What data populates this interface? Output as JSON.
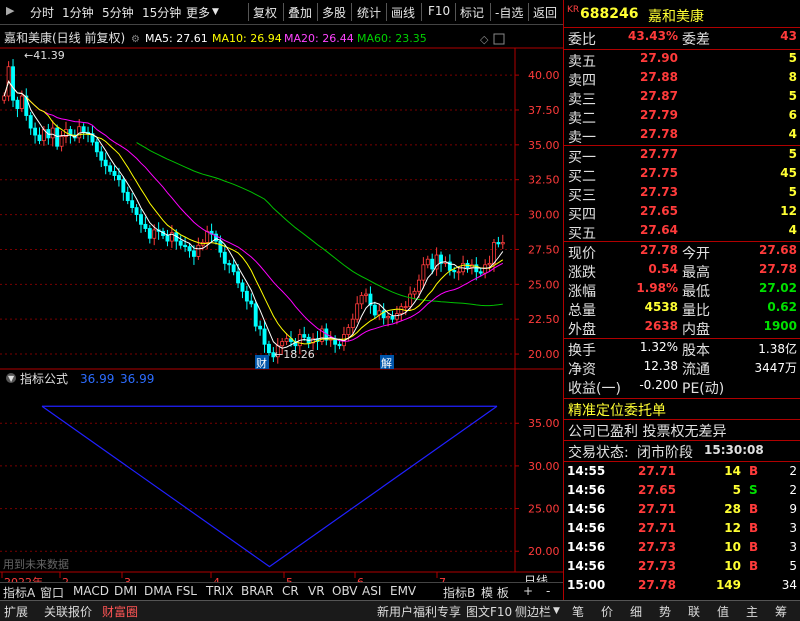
{
  "toolbar": {
    "left_items": [
      "分时",
      "1分钟",
      "5分钟",
      "15分钟",
      "更多"
    ],
    "right_items": [
      "复权",
      "叠加",
      "多股",
      "统计",
      "画线",
      "F10",
      "标记",
      "-自选",
      "返回"
    ]
  },
  "chart": {
    "title": "嘉和美康(日线 前复权)",
    "ma5_label": "MA5: 27.61",
    "ma10_label": "MA10: 26.94",
    "ma20_label": "MA20: 26.44",
    "ma60_label": "MA60: 23.35",
    "high_marker": "41.39",
    "low_marker": "18.26",
    "event_cai": "财",
    "event_jie": "解",
    "indicator_title": "指标公式",
    "indicator_val1": "36.99",
    "indicator_val2": "36.99",
    "future_note": "用到未来数据",
    "period_label": "日线",
    "colors": {
      "ma5": "#ffffff",
      "ma10": "#ffff00",
      "ma20": "#ff00ff",
      "ma60": "#00c000",
      "up": "#ff3b3b",
      "down": "#00ffff",
      "indicator": "#2020ff"
    }
  },
  "chart_data": [
    {
      "type": "candlestick",
      "title": "嘉和美康(日线 前复权)",
      "yticks": [
        "40.00",
        "37.50",
        "35.00",
        "32.50",
        "30.00",
        "27.50",
        "25.00",
        "22.50",
        "20.00"
      ],
      "ylim": [
        19.0,
        41.8
      ],
      "xticks": [
        "2022年",
        "2",
        "3",
        "4",
        "5",
        "6",
        "7"
      ],
      "series": [
        {
          "name": "MA5",
          "last": 27.61
        },
        {
          "name": "MA10",
          "last": 26.94
        },
        {
          "name": "MA20",
          "last": 26.44
        },
        {
          "name": "MA60",
          "last": 23.35
        }
      ],
      "annotations": [
        {
          "text": "41.39",
          "kind": "high"
        },
        {
          "text": "18.26",
          "kind": "low"
        }
      ],
      "close_series": [
        38.5,
        40.6,
        38.2,
        37.6,
        38.5,
        37.1,
        36.2,
        35.7,
        35.3,
        36.1,
        35.5,
        36.2,
        34.9,
        35.6,
        36.1,
        35.7,
        35.5,
        36.3,
        35.9,
        35.8,
        35.2,
        34.5,
        33.9,
        33.5,
        33.1,
        32.8,
        32.5,
        31.6,
        31.0,
        30.5,
        30.0,
        29.3,
        29.0,
        28.3,
        28.9,
        28.8,
        28.5,
        28.1,
        28.7,
        28.1,
        27.8,
        27.7,
        27.4,
        27.0,
        27.8,
        28.0,
        28.8,
        28.6,
        28.1,
        27.3,
        26.5,
        26.4,
        25.9,
        25.1,
        24.5,
        23.8,
        23.6,
        22.0,
        21.8,
        20.7,
        20.1,
        19.8,
        20.6,
        20.9,
        21.1,
        20.9,
        20.6,
        21.4,
        21.2,
        20.8,
        21.1,
        20.9,
        21.8,
        21.0,
        21.1,
        20.7,
        20.6,
        21.4,
        21.9,
        22.5,
        23.6,
        24.2,
        24.3,
        23.5,
        22.8,
        23.1,
        22.6,
        22.7,
        22.5,
        22.9,
        23.4,
        23.4,
        24.3,
        24.5,
        25.3,
        26.4,
        26.8,
        26.1,
        27.1,
        26.5,
        26.6,
        26.0,
        25.9,
        25.9,
        26.5,
        26.2,
        26.4,
        25.9,
        25.8,
        26.4,
        26.5,
        28.0,
        27.9,
        28.0
      ]
    },
    {
      "type": "line",
      "title": "指标公式",
      "yticks": [
        "35.00",
        "30.00",
        "25.00",
        "20.00"
      ],
      "ylim": [
        17.8,
        39.6
      ],
      "x": [
        0,
        0.5,
        1
      ],
      "values": [
        36.99,
        18.2,
        36.99
      ]
    }
  ],
  "quote": {
    "code_prefix": "KR",
    "code": "688246",
    "name": "嘉和美康",
    "weibi_label": "委比",
    "weibi": "43.43%",
    "weicha_label": "委差",
    "weicha": "43",
    "asks": [
      {
        "label": "卖五",
        "price": "27.90",
        "vol": "5"
      },
      {
        "label": "卖四",
        "price": "27.88",
        "vol": "8"
      },
      {
        "label": "卖三",
        "price": "27.87",
        "vol": "5"
      },
      {
        "label": "卖二",
        "price": "27.79",
        "vol": "6"
      },
      {
        "label": "卖一",
        "price": "27.78",
        "vol": "4"
      }
    ],
    "bids": [
      {
        "label": "买一",
        "price": "27.77",
        "vol": "5"
      },
      {
        "label": "买二",
        "price": "27.75",
        "vol": "45"
      },
      {
        "label": "买三",
        "price": "27.73",
        "vol": "5"
      },
      {
        "label": "买四",
        "price": "27.65",
        "vol": "12"
      },
      {
        "label": "买五",
        "price": "27.64",
        "vol": "4"
      }
    ],
    "stats": [
      {
        "l1": "现价",
        "v1": "27.78",
        "c1": "red",
        "l2": "今开",
        "v2": "27.68",
        "c2": "red"
      },
      {
        "l1": "涨跌",
        "v1": "0.54",
        "c1": "red",
        "l2": "最高",
        "v2": "27.78",
        "c2": "red"
      },
      {
        "l1": "涨幅",
        "v1": "1.98%",
        "c1": "red",
        "l2": "最低",
        "v2": "27.02",
        "c2": "grn"
      },
      {
        "l1": "总量",
        "v1": "4538",
        "c1": "yel",
        "l2": "量比",
        "v2": "0.62",
        "c2": "grn"
      },
      {
        "l1": "外盘",
        "v1": "2638",
        "c1": "red",
        "l2": "内盘",
        "v2": "1900",
        "c2": "grn"
      }
    ],
    "stats2": [
      {
        "l1": "换手",
        "v1": "1.32%",
        "l2": "股本",
        "v2": "1.38亿"
      },
      {
        "l1": "净资",
        "v1": "12.38",
        "l2": "流通",
        "v2": "3447万"
      },
      {
        "l1": "收益(一)",
        "v1": "-0.200",
        "l2": "PE(动)",
        "v2": ""
      }
    ],
    "promo": "精准定位委托单",
    "info": "公司已盈利 投票权无差异",
    "status_label": "交易状态:",
    "status_value": "闭市阶段",
    "status_time": "15:30:08",
    "trades": [
      {
        "time": "14:55",
        "price": "27.71",
        "vol": "14",
        "side": "B",
        "n": "2"
      },
      {
        "time": "14:56",
        "price": "27.65",
        "vol": "5",
        "side": "S",
        "n": "2"
      },
      {
        "time": "14:56",
        "price": "27.71",
        "vol": "28",
        "side": "B",
        "n": "9"
      },
      {
        "time": "14:56",
        "price": "27.71",
        "vol": "12",
        "side": "B",
        "n": "3"
      },
      {
        "time": "14:56",
        "price": "27.73",
        "vol": "10",
        "side": "B",
        "n": "3"
      },
      {
        "time": "14:56",
        "price": "27.73",
        "vol": "10",
        "side": "B",
        "n": "5"
      },
      {
        "time": "15:00",
        "price": "27.78",
        "vol": "149",
        "side": "",
        "n": "34"
      }
    ]
  },
  "indicator_tabs": [
    "指标A",
    "窗口",
    "MACD",
    "DMI",
    "DMA",
    "FSL",
    "TRIX",
    "BRAR",
    "CR",
    "VR",
    "OBV",
    "ASI",
    "EMV",
    "指标B",
    "模 板",
    "+",
    "-"
  ],
  "status_left": [
    "扩展",
    "关联报价",
    "财富圈"
  ],
  "status_mid": [
    "新用户福利专享",
    "图文F10",
    "侧边栏"
  ],
  "status_right": [
    "笔",
    "价",
    "细",
    "势",
    "联",
    "值",
    "主",
    "筹"
  ]
}
